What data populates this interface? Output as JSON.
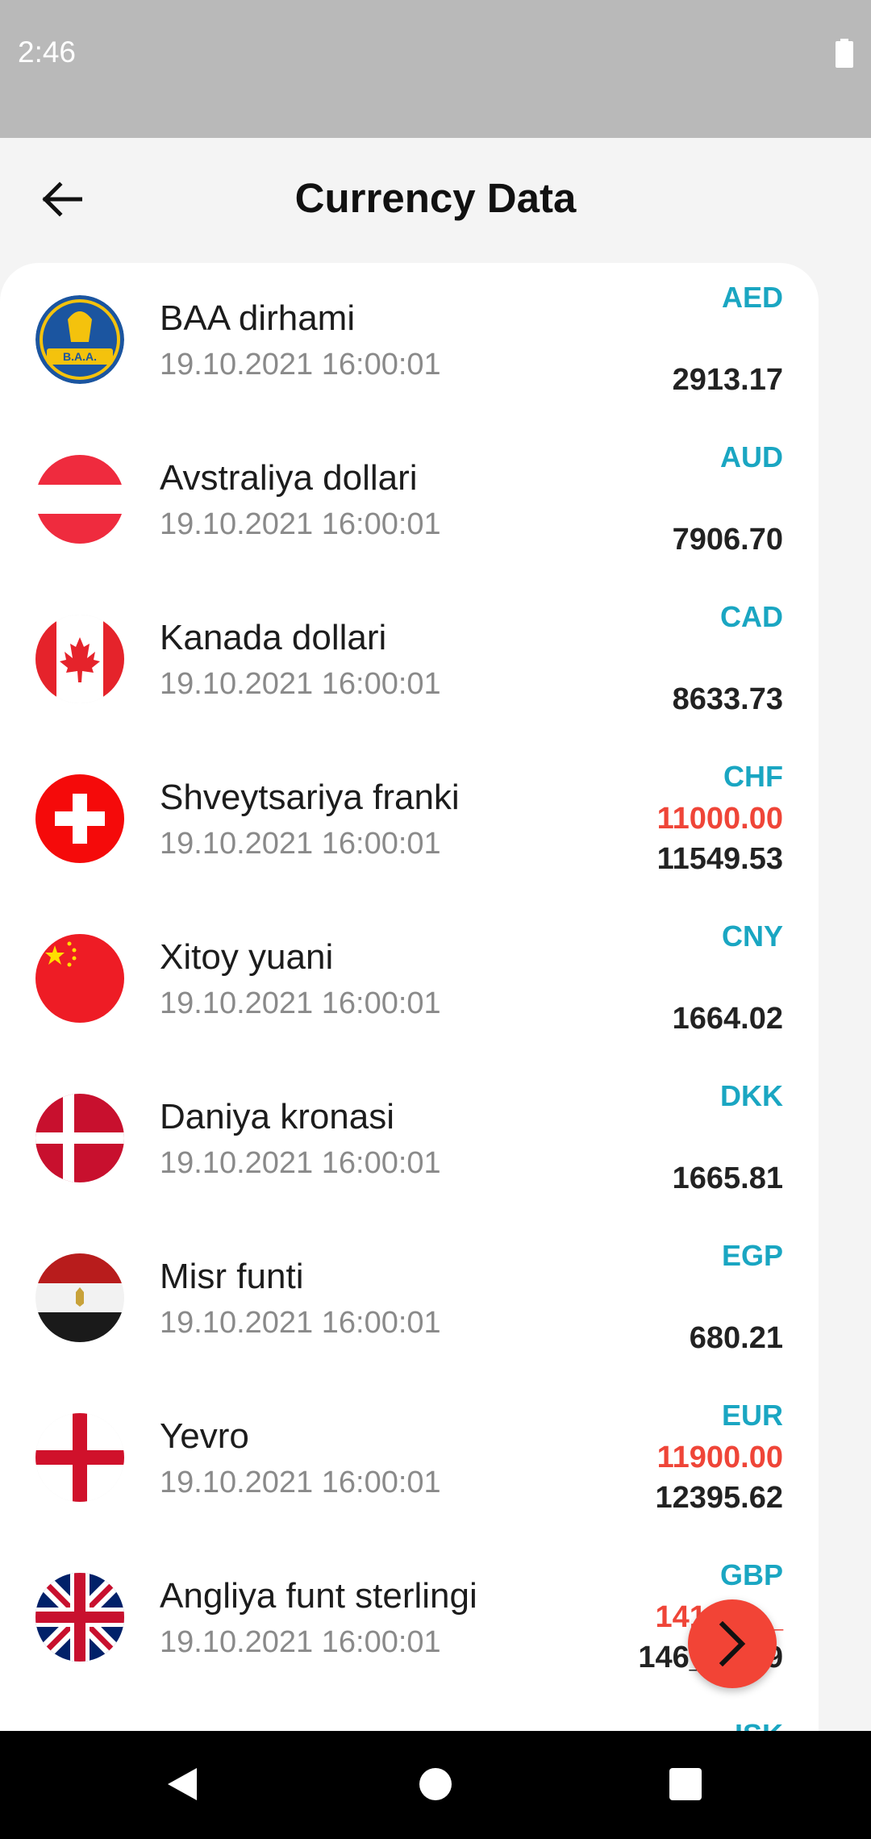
{
  "status_bar": {
    "time": "2:46"
  },
  "app_bar": {
    "title": "Currency Data"
  },
  "currencies": [
    {
      "name": "BAA dirhami",
      "date": "19.10.2021 16:00:01",
      "code": "AED",
      "buy": "",
      "rate": "2913.17",
      "flag": "uae-marathon-flag-icon"
    },
    {
      "name": "Avstraliya dollari",
      "date": "19.10.2021 16:00:01",
      "code": "AUD",
      "buy": "",
      "rate": "7906.70",
      "flag": "red-white-red-flag-icon"
    },
    {
      "name": "Kanada dollari",
      "date": "19.10.2021 16:00:01",
      "code": "CAD",
      "buy": "",
      "rate": "8633.73",
      "flag": "canada-flag-icon"
    },
    {
      "name": "Shveytsariya franki",
      "date": "19.10.2021 16:00:01",
      "code": "CHF",
      "buy": "11000.00",
      "rate": "11549.53",
      "flag": "switzerland-flag-icon"
    },
    {
      "name": "Xitoy yuani",
      "date": "19.10.2021 16:00:01",
      "code": "CNY",
      "buy": "",
      "rate": "1664.02",
      "flag": "china-flag-icon"
    },
    {
      "name": "Daniya kronasi",
      "date": "19.10.2021 16:00:01",
      "code": "DKK",
      "buy": "",
      "rate": "1665.81",
      "flag": "denmark-flag-icon"
    },
    {
      "name": "Misr funti",
      "date": "19.10.2021 16:00:01",
      "code": "EGP",
      "buy": "",
      "rate": "680.21",
      "flag": "egypt-flag-icon"
    },
    {
      "name": "Yevro",
      "date": "19.10.2021 16:00:01",
      "code": "EUR",
      "buy": "11900.00",
      "rate": "12395.62",
      "flag": "england-flag-icon"
    },
    {
      "name": "Angliya funt sterlingi",
      "date": "19.10.2021 16:00:01",
      "code": "GBP",
      "buy": "141__.__",
      "rate": "146__.__9",
      "flag": "uk-flag-icon"
    },
    {
      "name": "",
      "date": "",
      "code": "ISK",
      "buy": "",
      "rate": "",
      "flag": ""
    }
  ],
  "colors": {
    "code": "#1aa6c2",
    "buy": "#ef4538",
    "rate": "#222222",
    "fab": "#f24436"
  }
}
